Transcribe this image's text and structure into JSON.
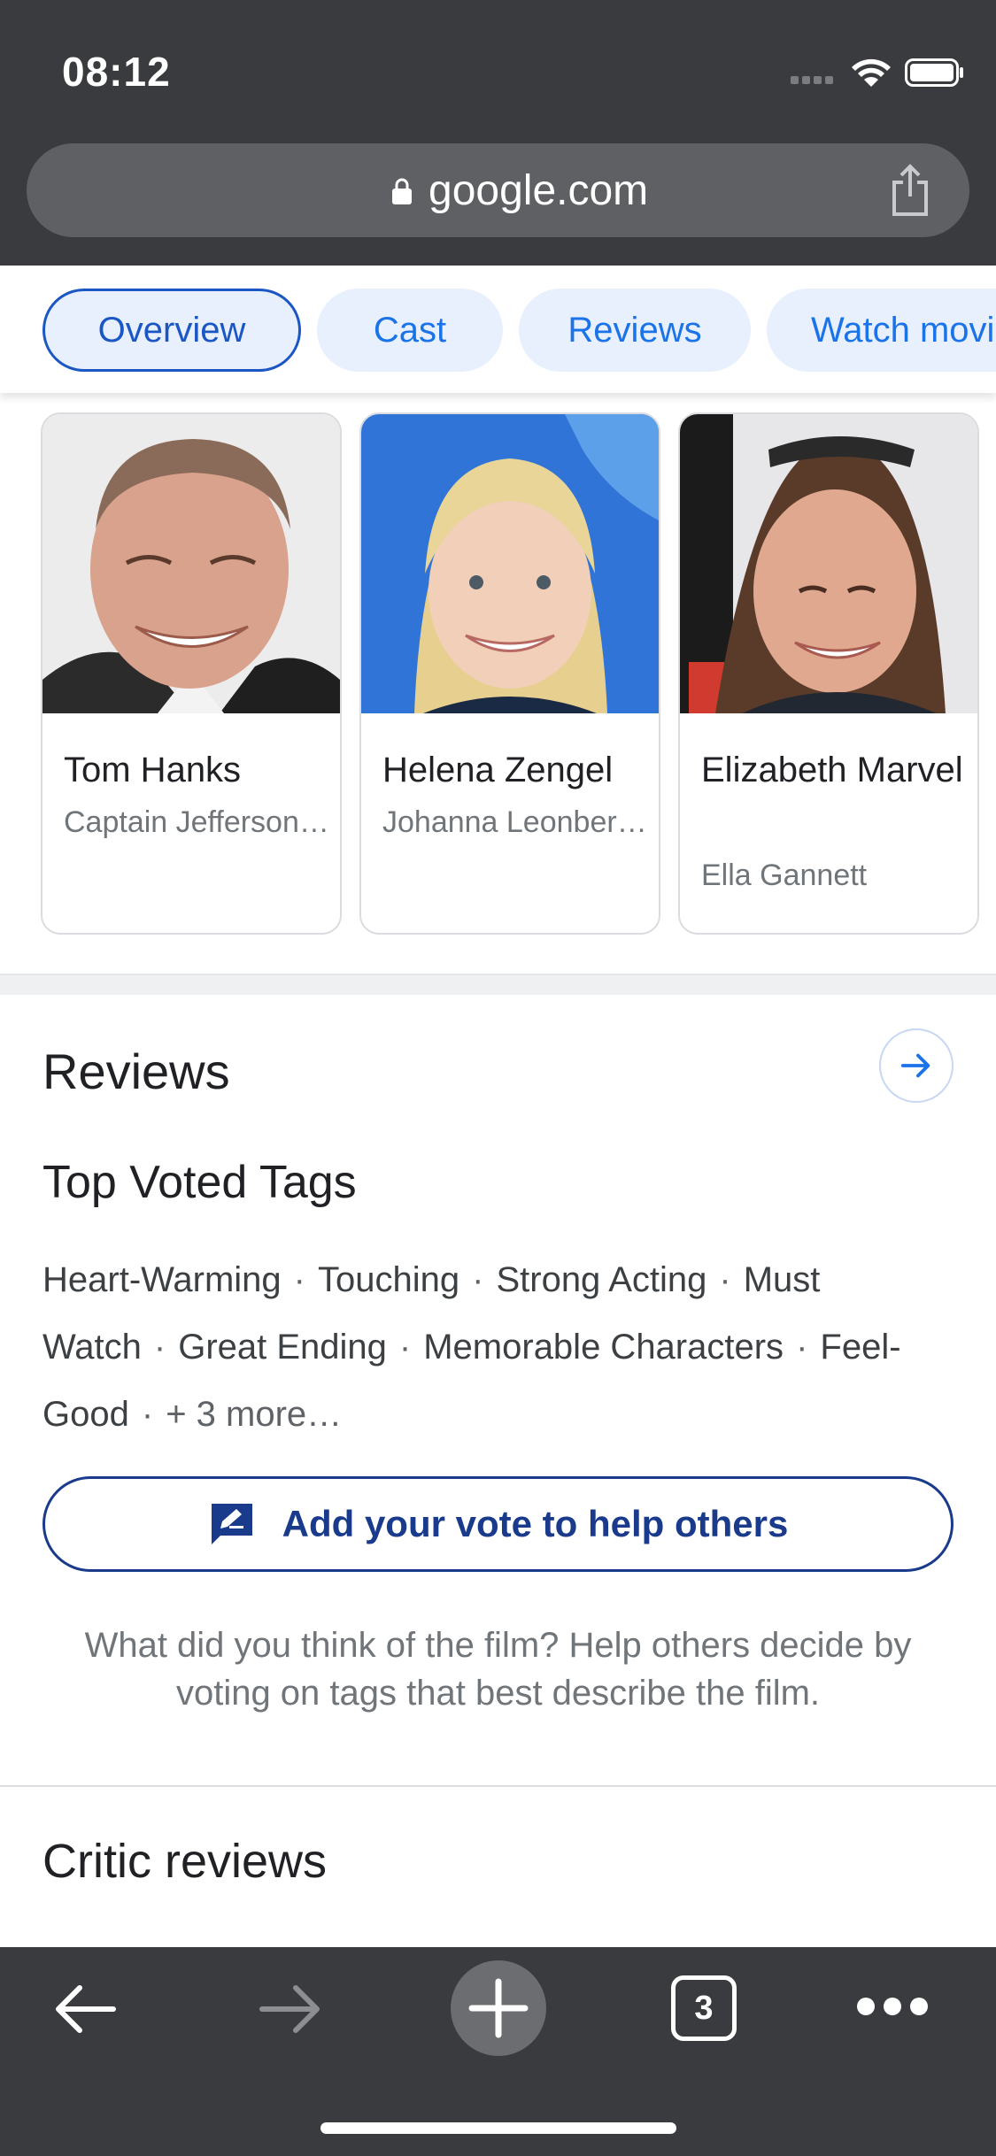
{
  "status": {
    "time": "08:12"
  },
  "browser": {
    "url": "google.com",
    "tab_count": "3"
  },
  "tabs": [
    {
      "label": "Overview",
      "active": true
    },
    {
      "label": "Cast",
      "active": false
    },
    {
      "label": "Reviews",
      "active": false
    },
    {
      "label": "Watch movie",
      "active": false
    }
  ],
  "cast": [
    {
      "name": "Tom Hanks",
      "role": "Captain Jefferson Kyle Kidd"
    },
    {
      "name": "Helena Zengel",
      "role": "Johanna Leonberger"
    },
    {
      "name": "Elizabeth Marvel",
      "role": "Ella Gannett"
    }
  ],
  "reviews": {
    "title": "Reviews",
    "tags_title": "Top Voted Tags",
    "tags": [
      "Heart-Warming",
      "Touching",
      "Strong Acting",
      "Must Watch",
      "Great Ending",
      "Memorable Characters",
      "Feel-Good"
    ],
    "more": "+ 3 more…",
    "separator": "·",
    "vote_button": "Add your vote to help others",
    "help_text": "What did you think of the film? Help others decide by voting on tags that best describe the film."
  },
  "critic": {
    "title": "Critic reviews"
  },
  "colors": {
    "accent": "#1a73e8",
    "chip_bg": "#e8f0fe",
    "chrome": "#3a3b3f",
    "vote": "#1a3a8c"
  },
  "icons": [
    "lock-icon",
    "share-icon",
    "arrow-right-icon",
    "edit-feedback-icon",
    "back-icon",
    "forward-icon",
    "new-tab-icon",
    "tabs-icon",
    "more-icon"
  ]
}
